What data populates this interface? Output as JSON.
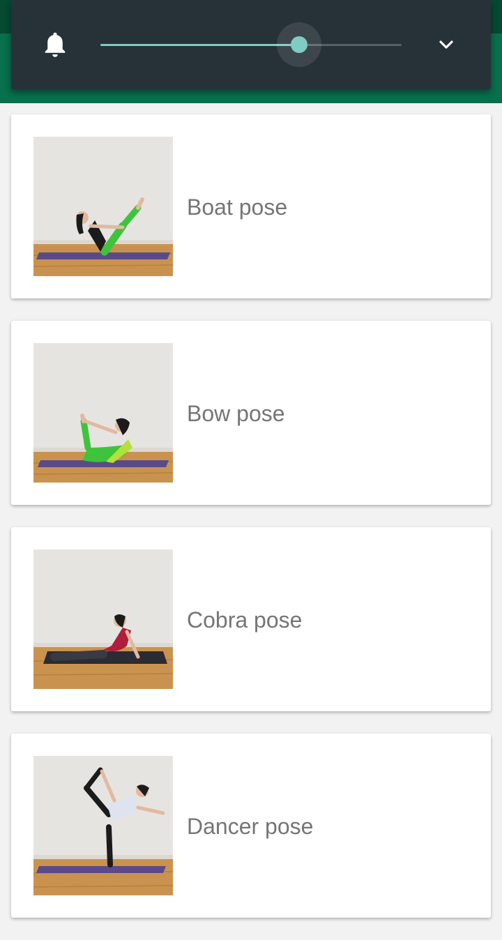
{
  "volume_panel": {
    "level_percent": 66,
    "icons": {
      "left": "bell-icon",
      "right": "chevron-down-icon"
    },
    "accent_color": "#80cbc4"
  },
  "app_bar": {
    "color": "#08704c",
    "status_bar_color": "#054a31"
  },
  "poses": [
    {
      "name": "Boat pose",
      "image": "woman-boat-pose-photo"
    },
    {
      "name": "Bow pose",
      "image": "woman-bow-pose-photo"
    },
    {
      "name": "Cobra pose",
      "image": "woman-cobra-pose-photo"
    },
    {
      "name": "Dancer pose",
      "image": "woman-dancer-pose-photo"
    }
  ]
}
